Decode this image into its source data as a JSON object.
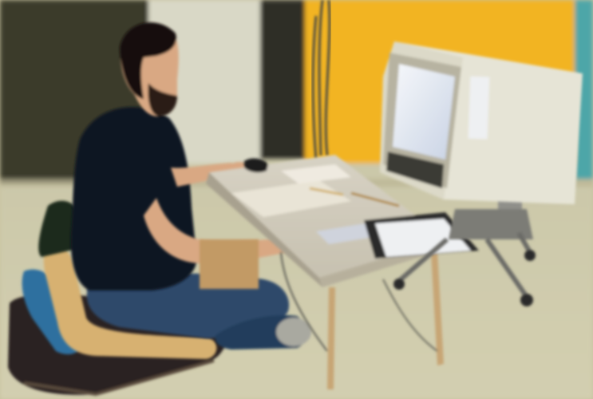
{
  "scene": {
    "kind": "photograph",
    "palette": {
      "floor": "#cfcaa6",
      "back_wall_left": "#3b3a2c",
      "column": "#d9d8c6",
      "orange_wall": "#f2b423",
      "teal_wall": "#4ea6a8",
      "shirt": "#0d1220",
      "jeans": "#2d4a6a",
      "skin": "#d9a883",
      "hair": "#17100c",
      "table_top": "#d8d3c4",
      "monitor_shell": "#e6e4d6",
      "screen": "#e9eef6",
      "cushion": "#2b2320",
      "blue_pillow": "#2f6f9f",
      "tan_pillow": "#d7b171",
      "dark_book": "#2b2a2a"
    },
    "objects": [
      "person-seated-on-floor",
      "low-desk",
      "crt-terminal-monitor",
      "monitor-stand-cart",
      "floor-cushion",
      "notebook-on-desk",
      "mouse-device"
    ]
  }
}
